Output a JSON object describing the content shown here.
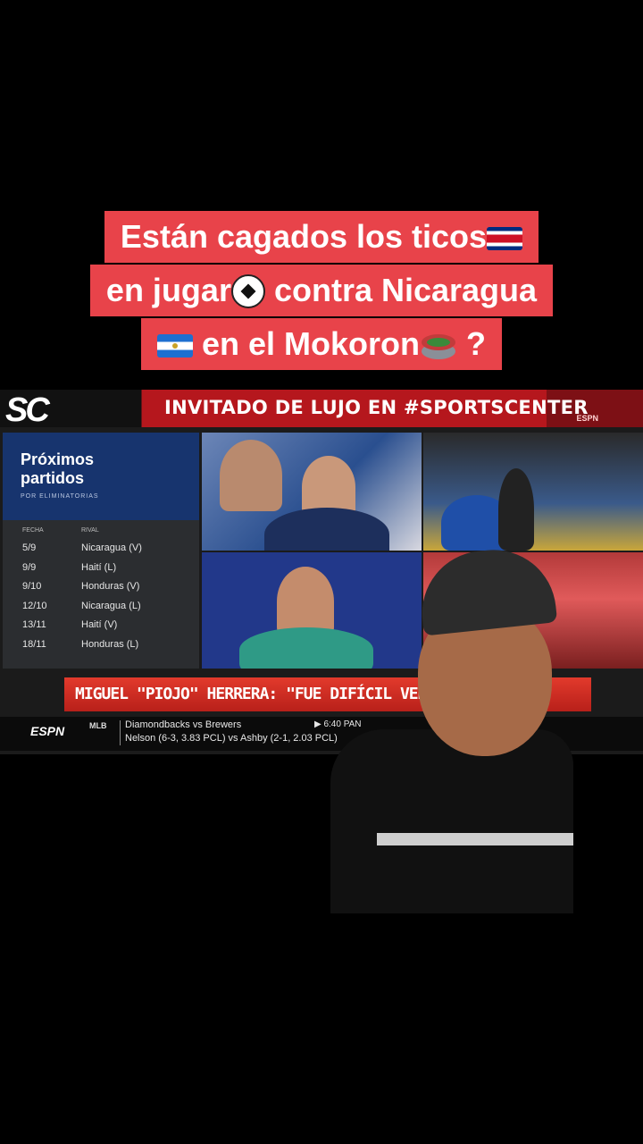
{
  "caption": {
    "line1": "Están cagados los ticos",
    "line2a": "en jugar",
    "line2b": " contra Nicaragua",
    "line3": " en el Mokoron",
    "line3_end": " ?"
  },
  "broadcast": {
    "logo": "SC",
    "banner": "INVITADO DE LUJO EN #SPORTSCENTER",
    "banner_tag": "ESPN",
    "schedule": {
      "title1": "Próximos",
      "title2": "partidos",
      "subtitle": "POR ELIMINATORIAS",
      "col_date": "FECHA",
      "col_opp": "RIVAL",
      "rows": [
        {
          "date": "5/9",
          "rival": "Nicaragua (V)"
        },
        {
          "date": "9/9",
          "rival": "Haití (L)"
        },
        {
          "date": "9/10",
          "rival": "Honduras (V)"
        },
        {
          "date": "12/10",
          "rival": "Nicaragua (L)"
        },
        {
          "date": "13/11",
          "rival": "Haití (V)"
        },
        {
          "date": "18/11",
          "rival": "Honduras (L)"
        }
      ]
    },
    "lower_third": "MIGUEL \"PIOJO\" HERRERA: \"FUE DIFÍCIL VER LA ELIMINACIÓN DE COSTA RICA EN LA COPA ORO\" ...SSA\"",
    "lower_visible": "MIGUEL \"PIOJO\" HERRERA: \"FUE DIFÍCIL VER LA ELIM",
    "ticker": {
      "network": "ESPN",
      "league": "MLB",
      "line1": "Diamondbacks vs Brewers",
      "line2": "Nelson (6-3, 3.83 PCL) vs Ashby (2-1, 2.03 PCL)",
      "time": "▶ 6:40 PAN"
    }
  }
}
